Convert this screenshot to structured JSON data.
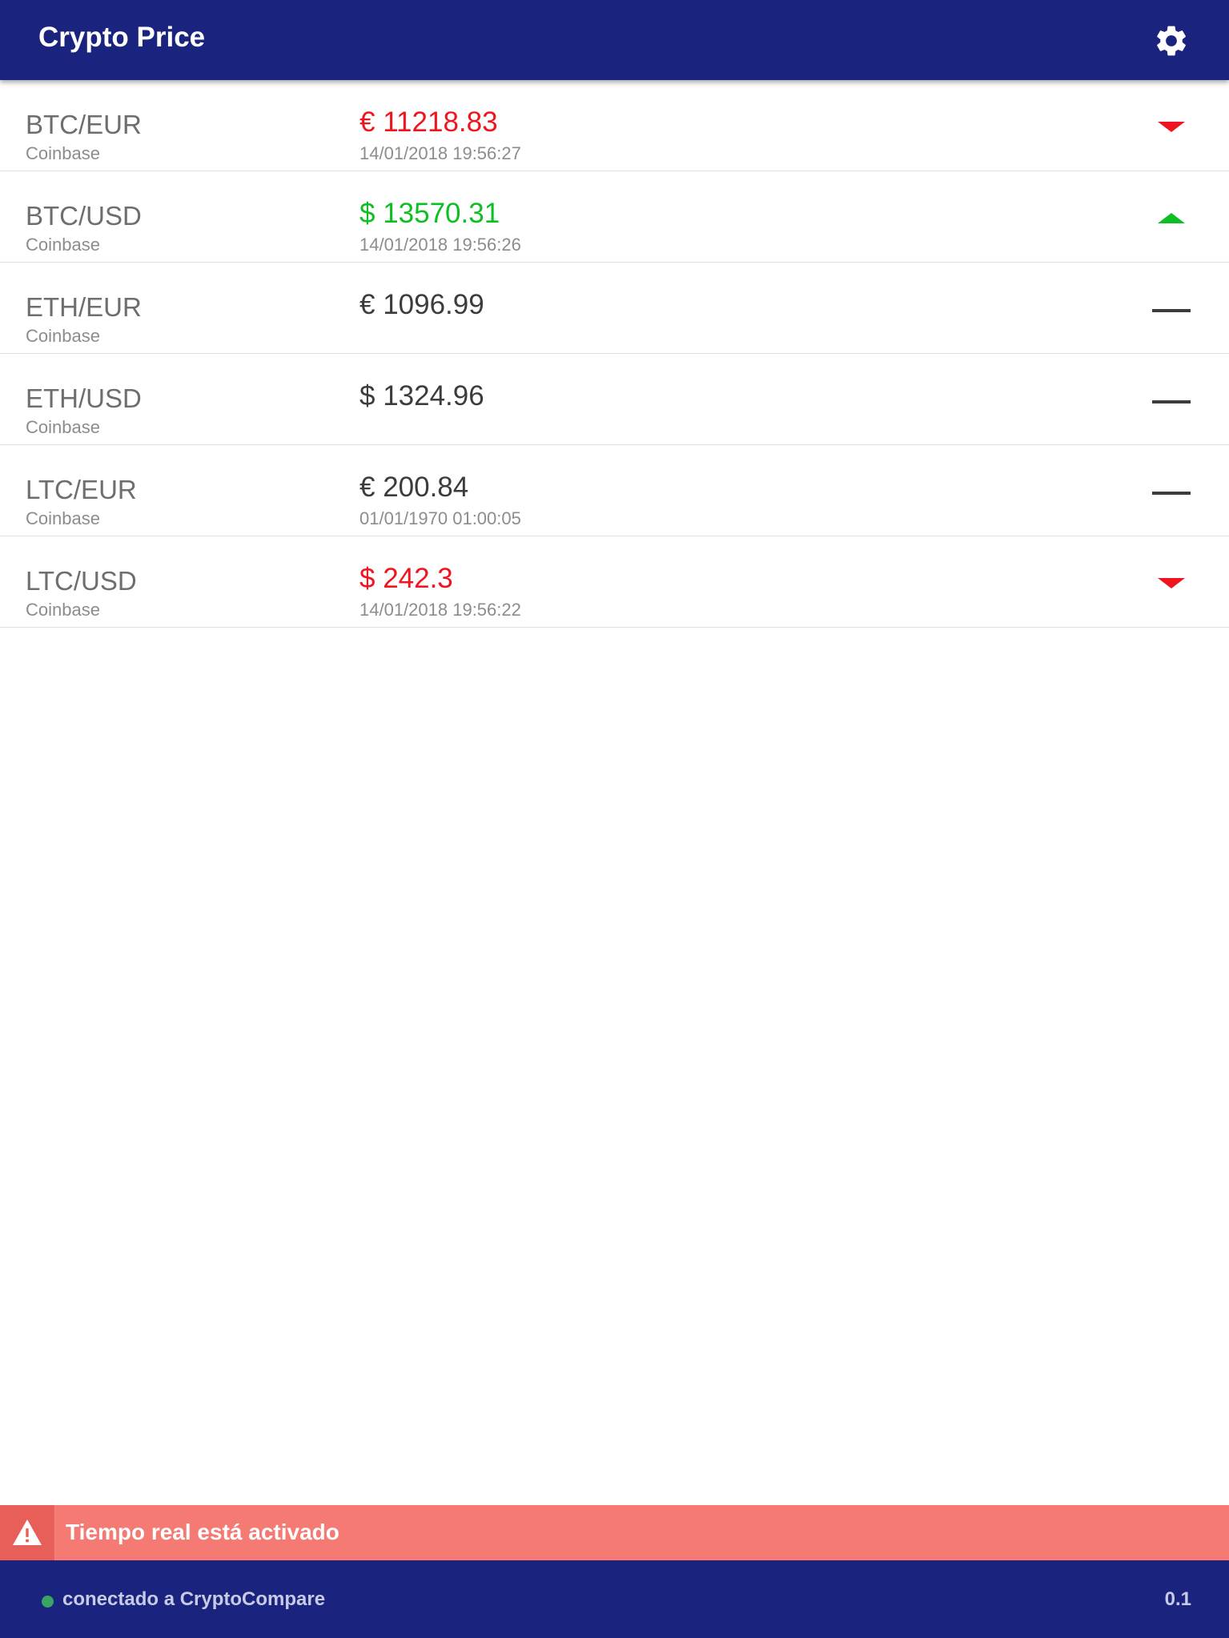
{
  "app": {
    "title": "Crypto Price",
    "settings_icon": "gear-icon"
  },
  "colors": {
    "header": "#1a237e",
    "price_down": "#f0141e",
    "price_up": "#0cbf22",
    "price_neutral": "#3c3c3c",
    "alert_bg": "#f47a73"
  },
  "rows": [
    {
      "pair": "BTC/EUR",
      "exchange": "Coinbase",
      "price": "€ 11218.83",
      "timestamp": "14/01/2018 19:56:27",
      "trend": "down"
    },
    {
      "pair": "BTC/USD",
      "exchange": "Coinbase",
      "price": "$ 13570.31",
      "timestamp": "14/01/2018 19:56:26",
      "trend": "up"
    },
    {
      "pair": "ETH/EUR",
      "exchange": "Coinbase",
      "price": "€ 1096.99",
      "timestamp": "",
      "trend": "neutral"
    },
    {
      "pair": "ETH/USD",
      "exchange": "Coinbase",
      "price": "$ 1324.96",
      "timestamp": "",
      "trend": "neutral"
    },
    {
      "pair": "LTC/EUR",
      "exchange": "Coinbase",
      "price": "€ 200.84",
      "timestamp": "01/01/1970 01:00:05",
      "trend": "neutral"
    },
    {
      "pair": "LTC/USD",
      "exchange": "Coinbase",
      "price": "$ 242.3",
      "timestamp": "14/01/2018 19:56:22",
      "trend": "down"
    }
  ],
  "alert": {
    "icon": "warning-icon",
    "text": "Tiempo real está activado"
  },
  "status": {
    "icon": "connection-dot-icon",
    "text": "conectado a CryptoCompare",
    "version": "0.1"
  }
}
